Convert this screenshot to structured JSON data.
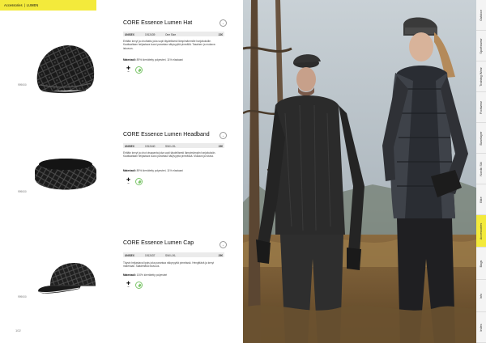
{
  "header": {
    "section": "Accessories",
    "subsection": "LUMEN"
  },
  "products": [
    {
      "title": "CORE Essence Lumen Hat",
      "spec": [
        "UNISEX",
        "1912439",
        "One Size",
        "22€"
      ],
      "description": "Erittäin kevyt ja ohuthattu joka sopii täydellisesti lämpimämmille harjoituksille. Kauttaaltaan heijastava kuosi parantaa näkyvyyttä pimeällä. Tasainen ja mukava istuvuus.",
      "material_label": "Materiaali:",
      "material_value": "89% kierrätetty polyesteri, 11% elastaani",
      "code": "999000"
    },
    {
      "title": "CORE Essence Lumen Headband",
      "spec": [
        "UNISEX",
        "1912440",
        "S/M L/XL",
        "19€"
      ],
      "description": "Erittäin kevyt ja ohut otsapanta joka sopii täydellisesti lämpimämpiin harjoituksiin. Kauttaaltaan heijastava kuosi parantaa näkyvyyttä pimeässä. Mukava ja istuva.",
      "material_label": "Materiaali:",
      "material_value": "89% kierrätetty polyesteri, 11% elastaani",
      "code": "999000"
    },
    {
      "title": "CORE Essence Lumen Cap",
      "spec": [
        "UNISEX",
        "1912437",
        "S/M L/XL",
        "29€"
      ],
      "description": "Täysin heijastava lippis joka parantaa näkyvyyttä pimeässä. Hengittävä ja kevyt materiaali. Säädettävä istuvuus.",
      "material_label": "Materiaali:",
      "material_value": "100% kierrätetty polyesteri",
      "code": "999000"
    }
  ],
  "page_number": "102",
  "side_tabs": [
    "Outdoor",
    "Sportswear",
    "Training Wear",
    "Footwear",
    "Baselayer",
    "Nordic Ski",
    "Bike",
    "Accessories",
    "Bags",
    "Info",
    "Index"
  ],
  "active_tab": "Accessories",
  "colors": {
    "accent": "#f3ea3b",
    "eco_green": "#7dc66b"
  },
  "icons": {
    "add": "plus-circle-icon",
    "feature": "plus-feature-icon",
    "eco": "leaf-icon"
  }
}
